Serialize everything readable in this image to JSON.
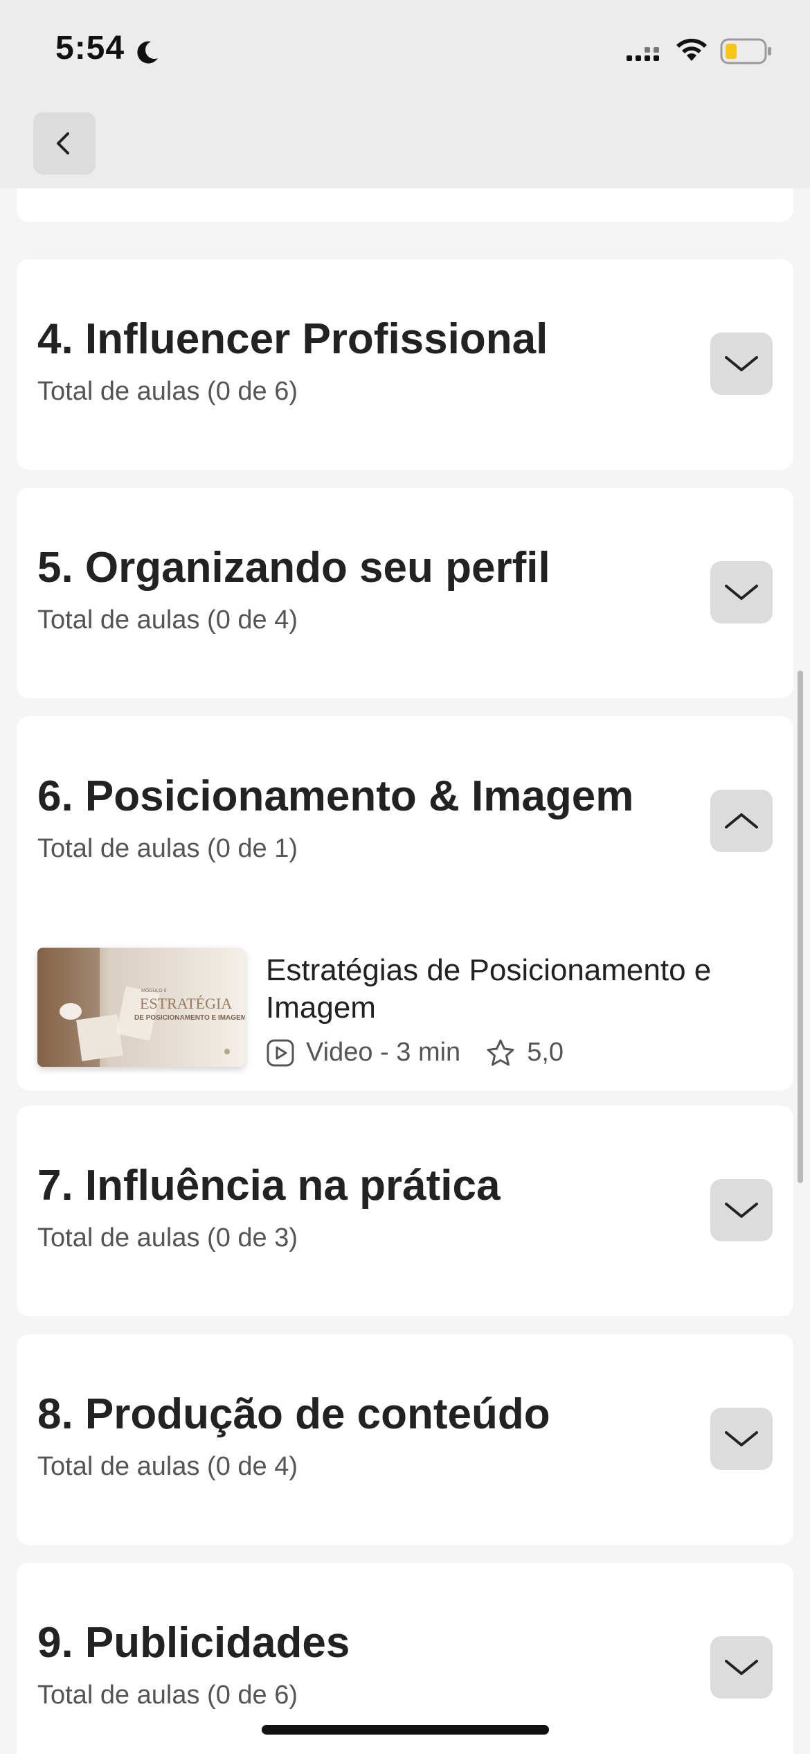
{
  "status_bar": {
    "time": "5:54"
  },
  "modules": [
    {
      "title": "4. Influencer Profissional",
      "subtitle": "Total de aulas (0 de 6)",
      "expanded": false
    },
    {
      "title": "5. Organizando seu perfil",
      "subtitle": "Total de aulas (0 de 4)",
      "expanded": false
    },
    {
      "title": "6. Posicionamento & Imagem",
      "subtitle": "Total de aulas (0 de 1)",
      "expanded": true
    },
    {
      "title": "7. Influência na prática",
      "subtitle": "Total de aulas (0 de 3)",
      "expanded": false
    },
    {
      "title": "8. Produção de conteúdo",
      "subtitle": "Total de aulas (0 de 4)",
      "expanded": false
    },
    {
      "title": "9. Publicidades",
      "subtitle": "Total de aulas (0 de 6)",
      "expanded": false
    }
  ],
  "lesson": {
    "title": "Estratégias de Posicionamento e Imagem",
    "type_duration": "Video - 3 min",
    "rating": "5,0",
    "thumbnail": {
      "kicker": "MÓDULO 6",
      "headline": "ESTRATÉGIA",
      "subline": "DE POSICIONAMENTO E IMAGEM"
    }
  },
  "colors": {
    "header_bg": "#ececec",
    "card_bg": "#ffffff",
    "page_bg": "#f5f5f5",
    "button_bg": "#dcdcdc",
    "battery_fill": "#f5c518"
  }
}
